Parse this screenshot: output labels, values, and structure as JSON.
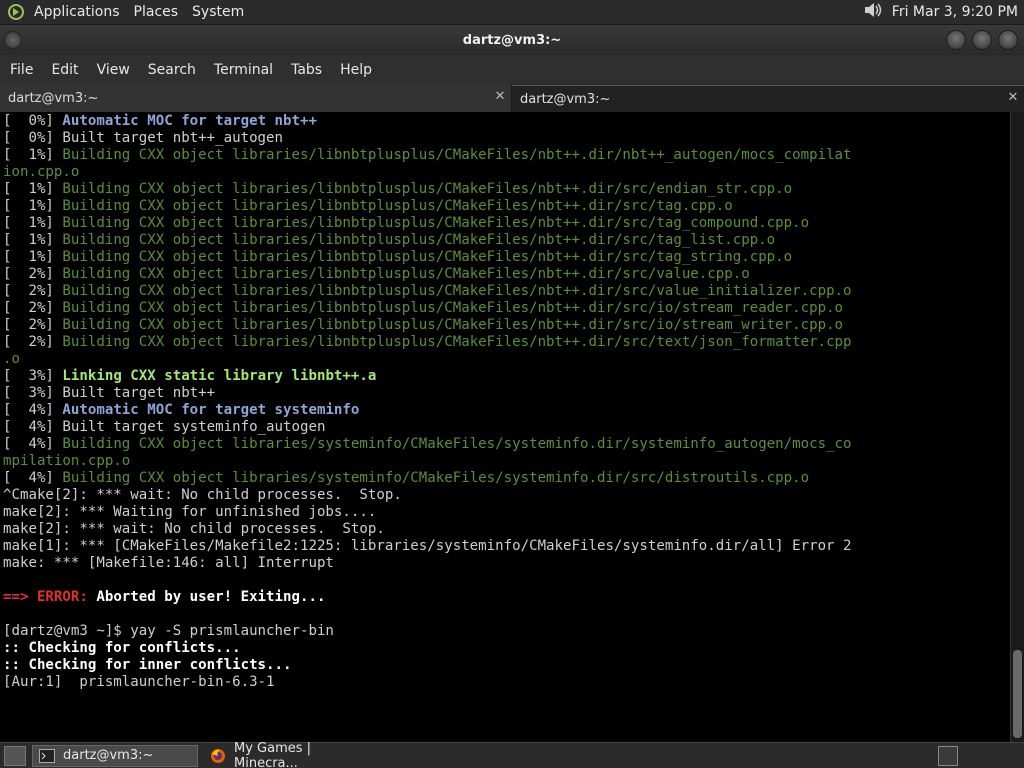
{
  "top_panel": {
    "menus": [
      "Applications",
      "Places",
      "System"
    ],
    "clock": "Fri Mar  3,  9:20 PM",
    "volume_icon": "speaker-icon"
  },
  "window": {
    "title": "dartz@vm3:~"
  },
  "menubar": [
    "File",
    "Edit",
    "View",
    "Search",
    "Terminal",
    "Tabs",
    "Help"
  ],
  "tabs": [
    {
      "label": "dartz@vm3:~",
      "active": false
    },
    {
      "label": "dartz@vm3:~",
      "active": true
    }
  ],
  "terminal": {
    "lines": [
      [
        {
          "t": "[  0%] ",
          "c": "dim"
        },
        {
          "t": "Automatic MOC for target nbt++",
          "c": "blue"
        }
      ],
      [
        {
          "t": "[  0%] Built target nbt++_autogen",
          "c": "dim"
        }
      ],
      [
        {
          "t": "[  1%] ",
          "c": "dim"
        },
        {
          "t": "Building CXX object libraries/libnbtplusplus/CMakeFiles/nbt++.dir/nbt++_autogen/mocs_compilat",
          "c": "green"
        }
      ],
      [
        {
          "t": "ion.cpp.o",
          "c": "green"
        }
      ],
      [
        {
          "t": "[  1%] ",
          "c": "dim"
        },
        {
          "t": "Building CXX object libraries/libnbtplusplus/CMakeFiles/nbt++.dir/src/endian_str.cpp.o",
          "c": "green"
        }
      ],
      [
        {
          "t": "[  1%] ",
          "c": "dim"
        },
        {
          "t": "Building CXX object libraries/libnbtplusplus/CMakeFiles/nbt++.dir/src/tag.cpp.o",
          "c": "green"
        }
      ],
      [
        {
          "t": "[  1%] ",
          "c": "dim"
        },
        {
          "t": "Building CXX object libraries/libnbtplusplus/CMakeFiles/nbt++.dir/src/tag_compound.cpp.o",
          "c": "green"
        }
      ],
      [
        {
          "t": "[  1%] ",
          "c": "dim"
        },
        {
          "t": "Building CXX object libraries/libnbtplusplus/CMakeFiles/nbt++.dir/src/tag_list.cpp.o",
          "c": "green"
        }
      ],
      [
        {
          "t": "[  1%] ",
          "c": "dim"
        },
        {
          "t": "Building CXX object libraries/libnbtplusplus/CMakeFiles/nbt++.dir/src/tag_string.cpp.o",
          "c": "green"
        }
      ],
      [
        {
          "t": "[  2%] ",
          "c": "dim"
        },
        {
          "t": "Building CXX object libraries/libnbtplusplus/CMakeFiles/nbt++.dir/src/value.cpp.o",
          "c": "green"
        }
      ],
      [
        {
          "t": "[  2%] ",
          "c": "dim"
        },
        {
          "t": "Building CXX object libraries/libnbtplusplus/CMakeFiles/nbt++.dir/src/value_initializer.cpp.o",
          "c": "green"
        }
      ],
      [
        {
          "t": "[  2%] ",
          "c": "dim"
        },
        {
          "t": "Building CXX object libraries/libnbtplusplus/CMakeFiles/nbt++.dir/src/io/stream_reader.cpp.o",
          "c": "green"
        }
      ],
      [
        {
          "t": "[  2%] ",
          "c": "dim"
        },
        {
          "t": "Building CXX object libraries/libnbtplusplus/CMakeFiles/nbt++.dir/src/io/stream_writer.cpp.o",
          "c": "green"
        }
      ],
      [
        {
          "t": "[  2%] ",
          "c": "dim"
        },
        {
          "t": "Building CXX object libraries/libnbtplusplus/CMakeFiles/nbt++.dir/src/text/json_formatter.cpp",
          "c": "green"
        }
      ],
      [
        {
          "t": ".o",
          "c": "green"
        }
      ],
      [
        {
          "t": "[  3%] ",
          "c": "dim"
        },
        {
          "t": "Linking CXX static library libnbt++.a",
          "c": "lgreen"
        }
      ],
      [
        {
          "t": "[  3%] Built target nbt++",
          "c": "dim"
        }
      ],
      [
        {
          "t": "[  4%] ",
          "c": "dim"
        },
        {
          "t": "Automatic MOC for target systeminfo",
          "c": "blue"
        }
      ],
      [
        {
          "t": "[  4%] Built target systeminfo_autogen",
          "c": "dim"
        }
      ],
      [
        {
          "t": "[  4%] ",
          "c": "dim"
        },
        {
          "t": "Building CXX object libraries/systeminfo/CMakeFiles/systeminfo.dir/systeminfo_autogen/mocs_co",
          "c": "green"
        }
      ],
      [
        {
          "t": "mpilation.cpp.o",
          "c": "green"
        }
      ],
      [
        {
          "t": "[  4%] ",
          "c": "dim"
        },
        {
          "t": "Building CXX object libraries/systeminfo/CMakeFiles/systeminfo.dir/src/distroutils.cpp.o",
          "c": "green"
        }
      ],
      [
        {
          "t": "^Cmake[2]: *** wait: No child processes.  Stop.",
          "c": "dim"
        }
      ],
      [
        {
          "t": "make[2]: *** Waiting for unfinished jobs....",
          "c": "dim"
        }
      ],
      [
        {
          "t": "make[2]: *** wait: No child processes.  Stop.",
          "c": "dim"
        }
      ],
      [
        {
          "t": "make[1]: *** [CMakeFiles/Makefile2:1225: libraries/systeminfo/CMakeFiles/systeminfo.dir/all] Error 2",
          "c": "dim"
        }
      ],
      [
        {
          "t": "make: *** [Makefile:146: all] Interrupt",
          "c": "dim"
        }
      ],
      [
        {
          "t": "",
          "c": "dim"
        }
      ],
      [
        {
          "t": "==> ERROR: ",
          "c": "red"
        },
        {
          "t": "Aborted by user! Exiting...",
          "c": "white"
        }
      ],
      [
        {
          "t": "",
          "c": "dim"
        }
      ],
      [
        {
          "t": "[dartz@vm3 ~]$ yay -S prismlauncher-bin",
          "c": "dim"
        }
      ],
      [
        {
          "t": ":: Checking for conflicts...",
          "c": "white"
        }
      ],
      [
        {
          "t": ":: Checking for inner conflicts...",
          "c": "white"
        }
      ],
      [
        {
          "t": "[Aur:1]  prismlauncher-bin-6.3-1",
          "c": "dim"
        }
      ]
    ]
  },
  "taskbar": {
    "items": [
      {
        "label": "dartz@vm3:~",
        "icon": "terminal-icon",
        "active": true
      },
      {
        "label": "My Games | Minecra...",
        "icon": "firefox-icon",
        "active": false
      }
    ]
  },
  "colors": {
    "panel_bg": "#2b2b2b",
    "term_bg": "#000000",
    "green": "#5a8f3a",
    "blue": "#8fa5d8",
    "red": "#e03030"
  }
}
